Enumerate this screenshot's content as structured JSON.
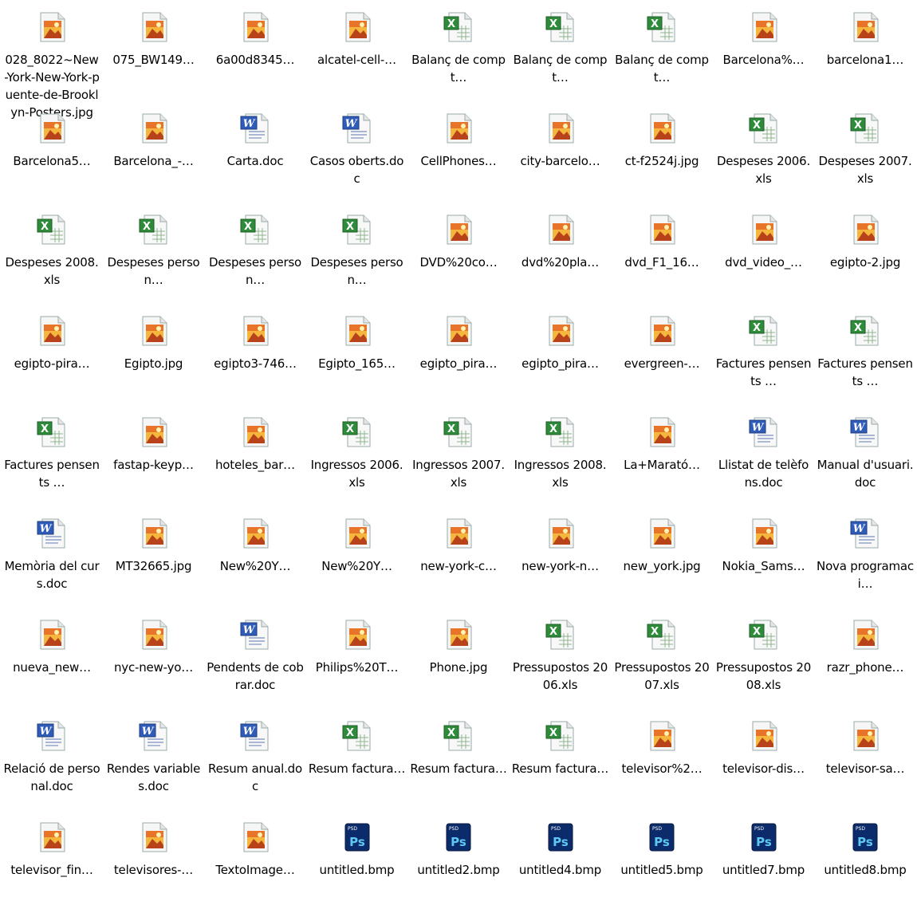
{
  "window": {
    "title": ""
  },
  "files": [
    {
      "label": "028_8022~New-York-New-York-puente-de-Brooklyn-Posters.jpg",
      "icon": "image-icon"
    },
    {
      "label": "075_BW149…",
      "icon": "image-icon"
    },
    {
      "label": "6a00d8345…",
      "icon": "image-icon"
    },
    {
      "label": "alcatel-cell-…",
      "icon": "image-icon"
    },
    {
      "label": "Balanç de compt…",
      "icon": "excel-icon"
    },
    {
      "label": "Balanç de compt…",
      "icon": "excel-icon"
    },
    {
      "label": "Balanç de compt…",
      "icon": "excel-icon"
    },
    {
      "label": "Barcelona%…",
      "icon": "image-icon"
    },
    {
      "label": "barcelona1…",
      "icon": "image-icon"
    },
    {
      "label": "Barcelona5…",
      "icon": "image-icon"
    },
    {
      "label": "Barcelona_-…",
      "icon": "image-icon"
    },
    {
      "label": "Carta.doc",
      "icon": "word-icon"
    },
    {
      "label": "Casos oberts.doc",
      "icon": "word-icon"
    },
    {
      "label": "CellPhones…",
      "icon": "image-icon"
    },
    {
      "label": "city-barcelo…",
      "icon": "image-icon"
    },
    {
      "label": "ct-f2524j.jpg",
      "icon": "image-icon"
    },
    {
      "label": "Despeses 2006.xls",
      "icon": "excel-icon"
    },
    {
      "label": "Despeses 2007.xls",
      "icon": "excel-icon"
    },
    {
      "label": "Despeses 2008.xls",
      "icon": "excel-icon"
    },
    {
      "label": "Despeses person…",
      "icon": "excel-icon"
    },
    {
      "label": "Despeses person…",
      "icon": "excel-icon"
    },
    {
      "label": "Despeses person…",
      "icon": "excel-icon"
    },
    {
      "label": "DVD%20co…",
      "icon": "image-icon"
    },
    {
      "label": "dvd%20pla…",
      "icon": "image-icon"
    },
    {
      "label": "dvd_F1_16…",
      "icon": "image-icon"
    },
    {
      "label": "dvd_video_…",
      "icon": "image-icon"
    },
    {
      "label": "egipto-2.jpg",
      "icon": "image-icon"
    },
    {
      "label": "egipto-pira…",
      "icon": "image-icon"
    },
    {
      "label": "Egipto.jpg",
      "icon": "image-icon"
    },
    {
      "label": "egipto3-746…",
      "icon": "image-icon"
    },
    {
      "label": "Egipto_165…",
      "icon": "image-icon"
    },
    {
      "label": "egipto_pira…",
      "icon": "image-icon"
    },
    {
      "label": "egipto_pira…",
      "icon": "image-icon"
    },
    {
      "label": "evergreen-…",
      "icon": "image-icon"
    },
    {
      "label": "Factures pensents …",
      "icon": "excel-icon"
    },
    {
      "label": "Factures pensents …",
      "icon": "excel-icon"
    },
    {
      "label": "Factures pensents …",
      "icon": "excel-icon"
    },
    {
      "label": "fastap-keyp…",
      "icon": "image-icon"
    },
    {
      "label": "hoteles_bar…",
      "icon": "image-icon"
    },
    {
      "label": "Ingressos 2006.xls",
      "icon": "excel-icon"
    },
    {
      "label": "Ingressos 2007.xls",
      "icon": "excel-icon"
    },
    {
      "label": "Ingressos 2008.xls",
      "icon": "excel-icon"
    },
    {
      "label": "La+Marató…",
      "icon": "image-icon"
    },
    {
      "label": "Llistat de telèfons.doc",
      "icon": "word-icon"
    },
    {
      "label": "Manual d'usuari.doc",
      "icon": "word-icon"
    },
    {
      "label": "Memòria del curs.doc",
      "icon": "word-icon"
    },
    {
      "label": "MT32665.jpg",
      "icon": "image-icon"
    },
    {
      "label": "New%20Y…",
      "icon": "image-icon"
    },
    {
      "label": "New%20Y…",
      "icon": "image-icon"
    },
    {
      "label": "new-york-c…",
      "icon": "image-icon"
    },
    {
      "label": "new-york-n…",
      "icon": "image-icon"
    },
    {
      "label": "new_york.jpg",
      "icon": "image-icon"
    },
    {
      "label": "Nokia_Sams…",
      "icon": "image-icon"
    },
    {
      "label": "Nova programaci…",
      "icon": "word-icon"
    },
    {
      "label": "nueva_new…",
      "icon": "image-icon"
    },
    {
      "label": "nyc-new-yo…",
      "icon": "image-icon"
    },
    {
      "label": "Pendents de cobrar.doc",
      "icon": "word-icon"
    },
    {
      "label": "Philips%20T…",
      "icon": "image-icon"
    },
    {
      "label": "Phone.jpg",
      "icon": "image-icon"
    },
    {
      "label": "Pressupostos 2006.xls",
      "icon": "excel-icon"
    },
    {
      "label": "Pressupostos 2007.xls",
      "icon": "excel-icon"
    },
    {
      "label": "Pressupostos 2008.xls",
      "icon": "excel-icon"
    },
    {
      "label": "razr_phone…",
      "icon": "image-icon"
    },
    {
      "label": "Relació de personal.doc",
      "icon": "word-icon"
    },
    {
      "label": "Rendes variables.doc",
      "icon": "word-icon"
    },
    {
      "label": "Resum anual.doc",
      "icon": "word-icon"
    },
    {
      "label": "Resum factura…",
      "icon": "excel-icon"
    },
    {
      "label": "Resum factura…",
      "icon": "excel-icon"
    },
    {
      "label": "Resum factura…",
      "icon": "excel-icon"
    },
    {
      "label": "televisor%2…",
      "icon": "image-icon"
    },
    {
      "label": "televisor-dis…",
      "icon": "image-icon"
    },
    {
      "label": "televisor-sa…",
      "icon": "image-icon"
    },
    {
      "label": "televisor_fin…",
      "icon": "image-icon"
    },
    {
      "label": "televisores-…",
      "icon": "image-icon"
    },
    {
      "label": "TextoImage…",
      "icon": "image-icon"
    },
    {
      "label": "untitled.bmp",
      "icon": "psd-icon"
    },
    {
      "label": "untitled2.bmp",
      "icon": "psd-icon"
    },
    {
      "label": "untitled4.bmp",
      "icon": "psd-icon"
    },
    {
      "label": "untitled5.bmp",
      "icon": "psd-icon"
    },
    {
      "label": "untitled7.bmp",
      "icon": "psd-icon"
    },
    {
      "label": "untitled8.bmp",
      "icon": "psd-icon"
    }
  ],
  "icon_text": {
    "word_badge": "W",
    "excel_badge": "X",
    "psd_tag": "PSD",
    "psd_badge": "Ps"
  },
  "colors": {
    "image_orange": "#e8742a",
    "image_gold": "#f4b63c",
    "excel_green": "#2e8b3a",
    "word_blue": "#2f5cb8",
    "psd_navy": "#0b2b6b",
    "psd_text": "#5ec8f5"
  }
}
